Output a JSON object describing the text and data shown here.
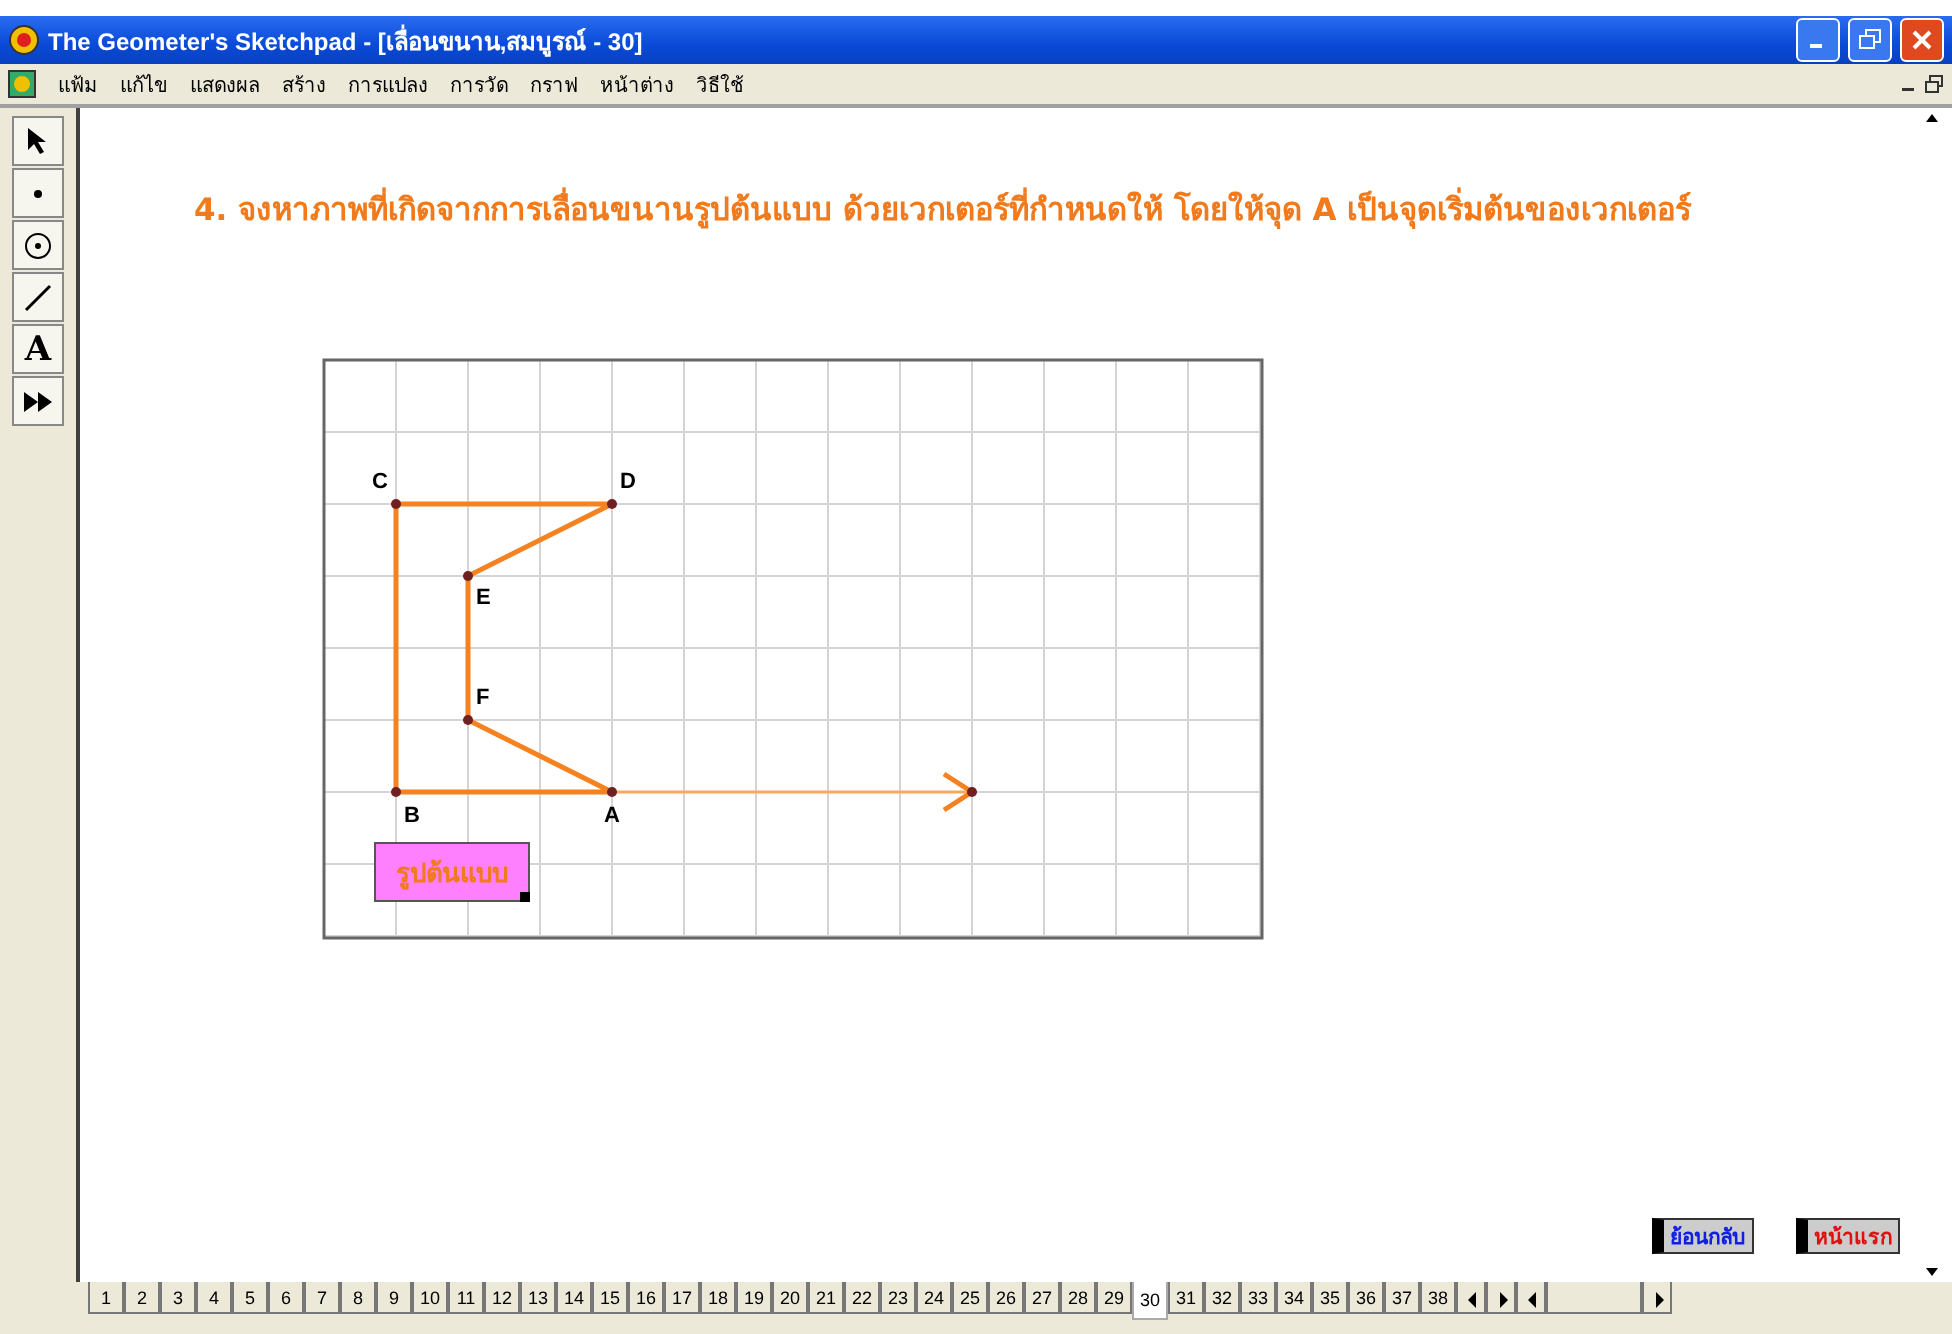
{
  "window": {
    "title": "The Geometer's Sketchpad - [เลื่อนขนาน,สมบูรณ์ - 30]"
  },
  "text_tool": "A",
  "menu": [
    "แฟ้ม",
    "แก้ไข",
    "แสดงผล",
    "สร้าง",
    "การแปลง",
    "การวัด",
    "กราฟ",
    "หน้าต่าง",
    "วิธีใช้"
  ],
  "instruction": "4. จงหาภาพที่เกิดจากการเลื่อนขนานรูปต้นแบบ  ด้วยเวกเตอร์ที่กำหนดให้ โดยให้จุด A เป็นจุดเริ่มต้นของเวกเตอร์",
  "sketch": {
    "points": [
      "C",
      "D",
      "E",
      "F",
      "B",
      "A"
    ],
    "caption": "รูปต้นแบบ"
  },
  "buttons": [
    {
      "label": "ย้อนกลับ",
      "kind": "back"
    },
    {
      "label": "หน้าแรก",
      "kind": "home"
    }
  ],
  "pages": [
    {
      "label": "1",
      "selected": false
    },
    {
      "label": "2",
      "selected": false
    },
    {
      "label": "3",
      "selected": false
    },
    {
      "label": "4",
      "selected": false
    },
    {
      "label": "5",
      "selected": false
    },
    {
      "label": "6",
      "selected": false
    },
    {
      "label": "7",
      "selected": false
    },
    {
      "label": "8",
      "selected": false
    },
    {
      "label": "9",
      "selected": false
    },
    {
      "label": "10",
      "selected": false
    },
    {
      "label": "11",
      "selected": false
    },
    {
      "label": "12",
      "selected": false
    },
    {
      "label": "13",
      "selected": false
    },
    {
      "label": "14",
      "selected": false
    },
    {
      "label": "15",
      "selected": false
    },
    {
      "label": "16",
      "selected": false
    },
    {
      "label": "17",
      "selected": false
    },
    {
      "label": "18",
      "selected": false
    },
    {
      "label": "19",
      "selected": false
    },
    {
      "label": "20",
      "selected": false
    },
    {
      "label": "21",
      "selected": false
    },
    {
      "label": "22",
      "selected": false
    },
    {
      "label": "23",
      "selected": false
    },
    {
      "label": "24",
      "selected": false
    },
    {
      "label": "25",
      "selected": false
    },
    {
      "label": "26",
      "selected": false
    },
    {
      "label": "27",
      "selected": false
    },
    {
      "label": "28",
      "selected": false
    },
    {
      "label": "29",
      "selected": false
    },
    {
      "label": "30",
      "selected": true
    },
    {
      "label": "31",
      "selected": false
    },
    {
      "label": "32",
      "selected": false
    },
    {
      "label": "33",
      "selected": false
    },
    {
      "label": "34",
      "selected": false
    },
    {
      "label": "35",
      "selected": false
    },
    {
      "label": "36",
      "selected": false
    },
    {
      "label": "37",
      "selected": false
    },
    {
      "label": "38",
      "selected": false
    }
  ]
}
